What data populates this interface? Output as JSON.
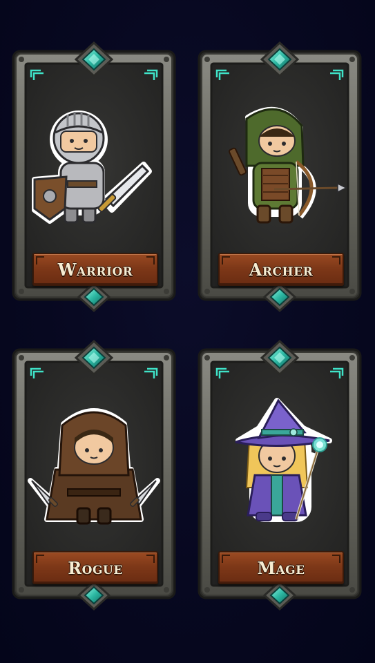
{
  "screen": "class-selection",
  "cards": [
    {
      "id": "warrior",
      "name": "Warrior",
      "icon": "warrior-knight-icon"
    },
    {
      "id": "archer",
      "name": "Archer",
      "icon": "archer-hooded-icon"
    },
    {
      "id": "rogue",
      "name": "Rogue",
      "icon": "rogue-daggers-icon"
    },
    {
      "id": "mage",
      "name": "Mage",
      "icon": "mage-witch-hat-icon"
    }
  ],
  "colors": {
    "background": "#06071d",
    "stone": "#6a6a64",
    "panel": "#2d2d2b",
    "gem": "#37c7b1",
    "rune": "#3fe3c8",
    "nameplate": "#7e3818",
    "label": "#f6ecd2"
  }
}
